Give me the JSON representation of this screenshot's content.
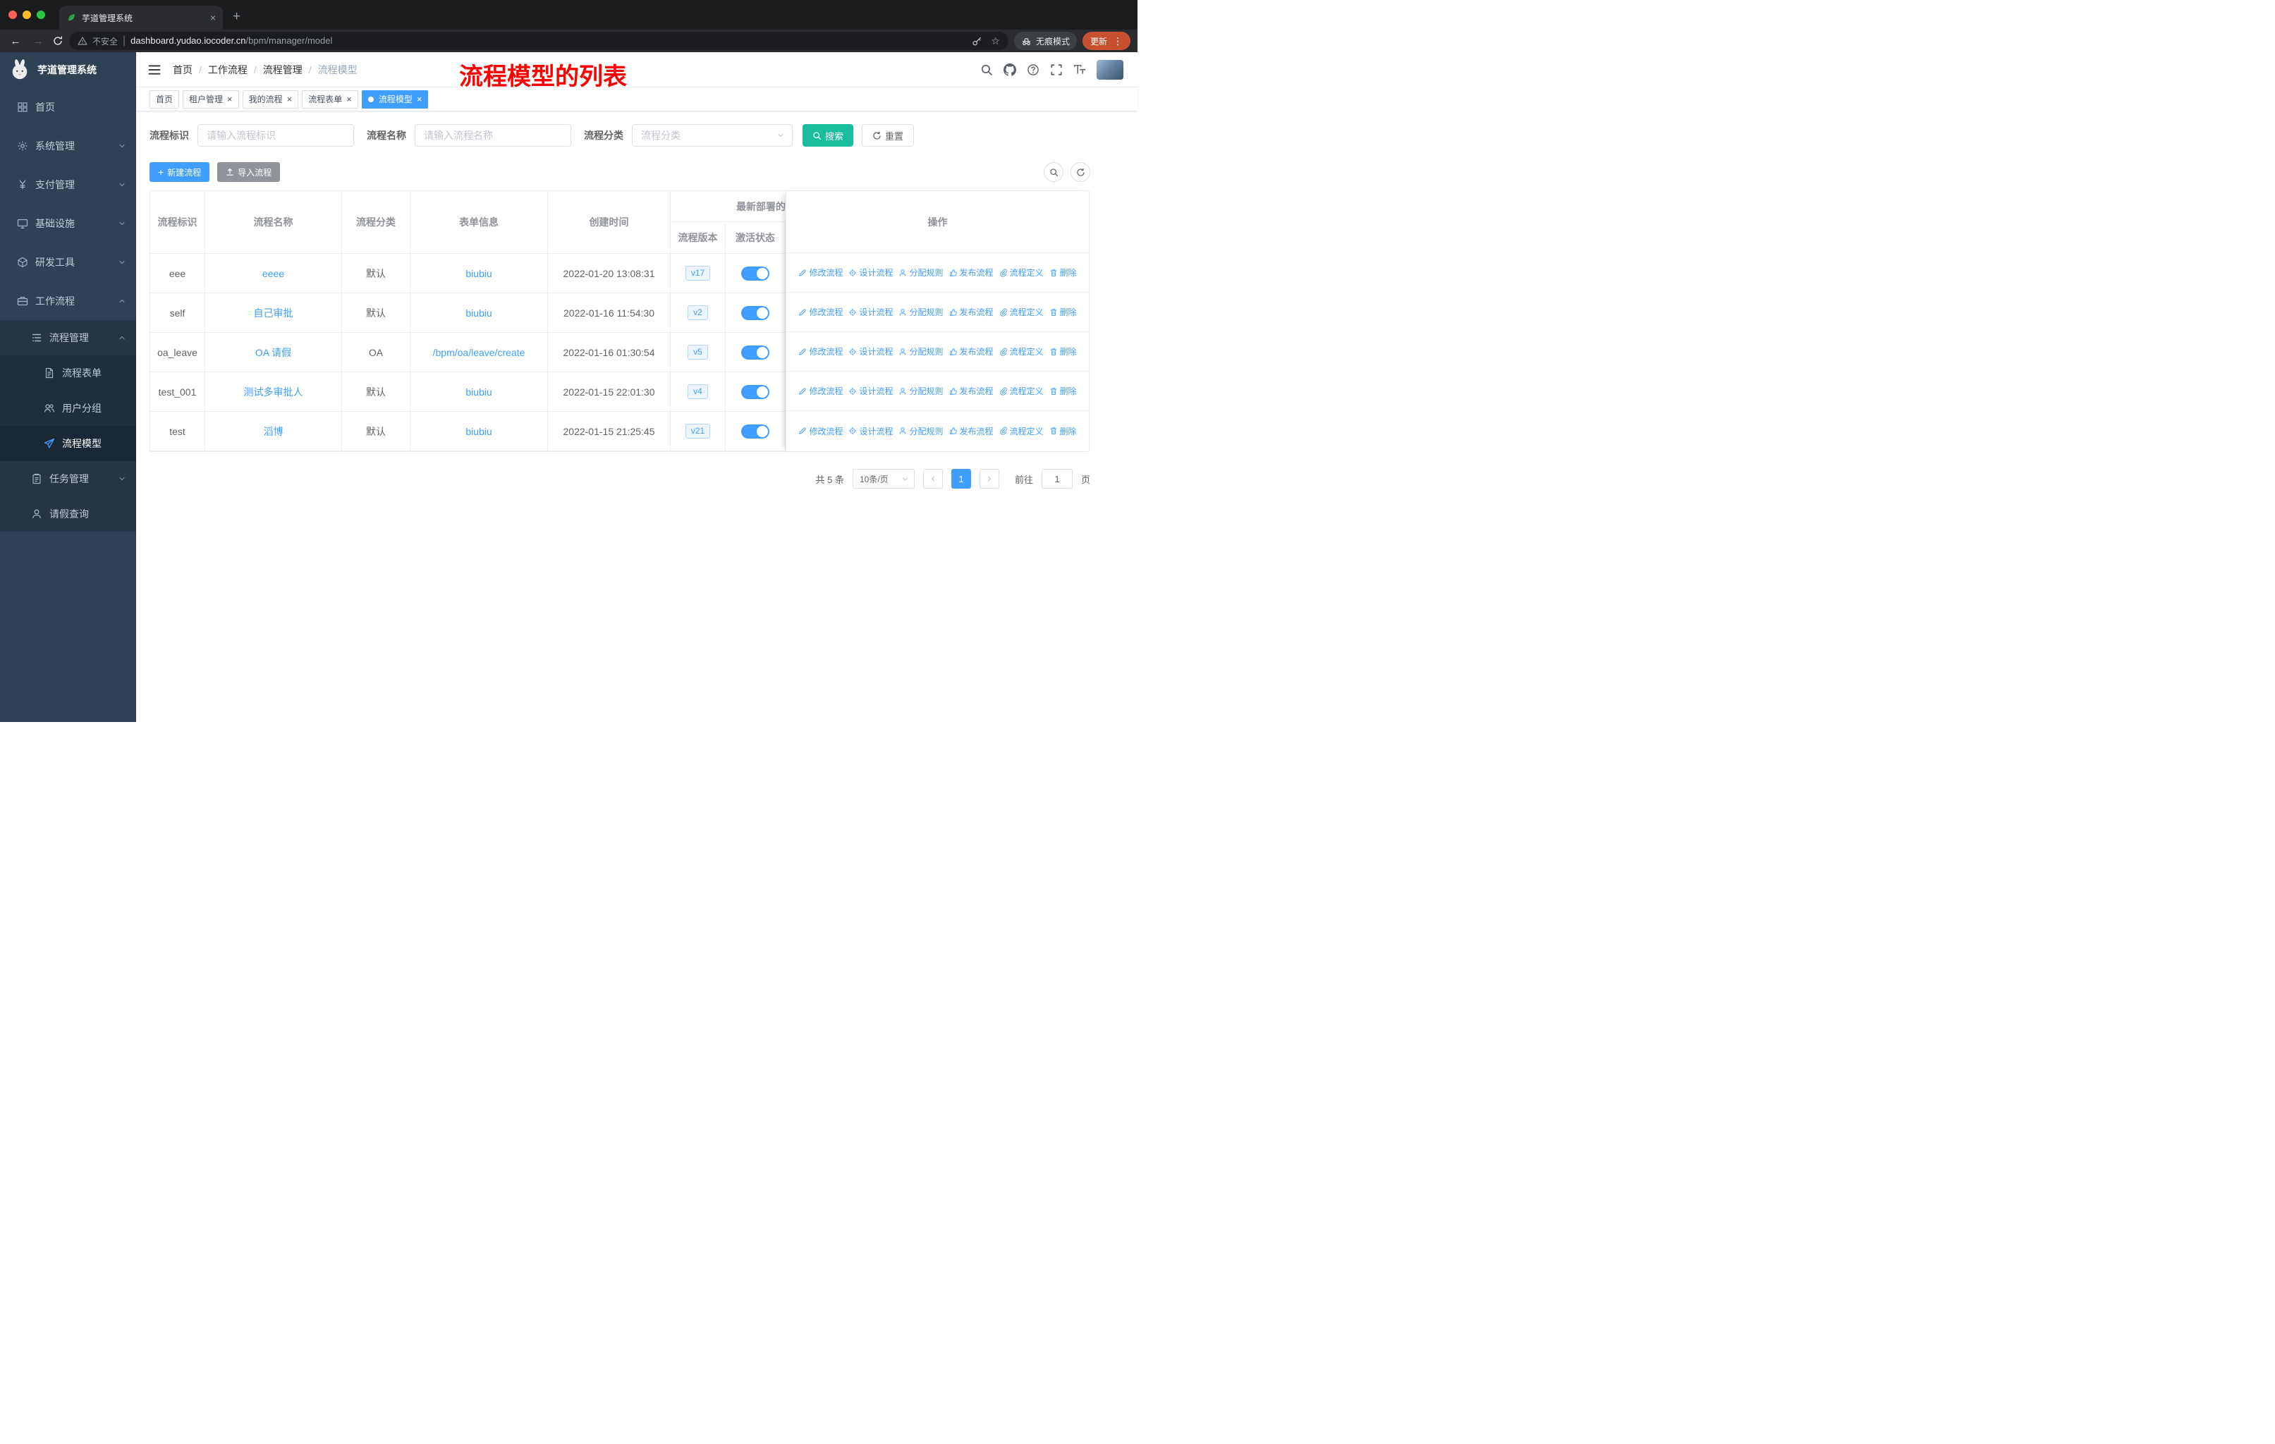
{
  "palette": {
    "accent": "#409EFF",
    "search_button": "#1ABC9C",
    "gray_button": "#909399",
    "sidebar_bg": "#304156",
    "submenu_bg": "#1F2D3D",
    "annotation_red": "#FF0000",
    "toggle_on": "#409EFF",
    "version_badge_bg": "#ECF5FF",
    "table_border": "#EBEEF5",
    "update_pill": "#C8502F"
  },
  "icons": {
    "close_icon": "×",
    "new_tab_icon": "+",
    "back_icon": "←",
    "forward_icon": "→",
    "overflow_menu_icon": "⋮",
    "star_icon": "☆",
    "plus_icon": "+"
  },
  "browser": {
    "tab_title": "芋道管理系统",
    "security_label": "不安全",
    "url_host": "dashboard.yudao.iocoder.cn",
    "url_path": "/bpm/manager/model",
    "incognito_label": "无痕模式",
    "update_label": "更新"
  },
  "sidebar": {
    "logo_title": "芋道管理系统",
    "items": [
      {
        "label": "首页",
        "icon": "dashboard-icon"
      },
      {
        "label": "系统管理",
        "icon": "gear-icon"
      },
      {
        "label": "支付管理",
        "icon": "payment-icon"
      },
      {
        "label": "基础设施",
        "icon": "infrastructure-icon"
      },
      {
        "label": "研发工具",
        "icon": "devtools-icon"
      },
      {
        "label": "工作流程",
        "icon": "workflow-icon"
      },
      {
        "label": "流程管理",
        "icon": "process-management-icon"
      },
      {
        "label": "流程表单",
        "icon": "form-icon"
      },
      {
        "label": "用户分组",
        "icon": "user-group-icon"
      },
      {
        "label": "流程模型",
        "icon": "process-model-icon"
      },
      {
        "label": "任务管理",
        "icon": "task-icon"
      },
      {
        "label": "请假查询",
        "icon": "leave-query-icon"
      }
    ]
  },
  "header": {
    "breadcrumb": [
      "首页",
      "工作流程",
      "流程管理",
      "流程模型"
    ],
    "breadcrumb_sep": "/",
    "annotation": "流程模型的列表"
  },
  "tags": [
    {
      "label": "首页"
    },
    {
      "label": "租户管理"
    },
    {
      "label": "我的流程"
    },
    {
      "label": "流程表单"
    },
    {
      "label": "流程模型"
    }
  ],
  "filters": {
    "key_label": "流程标识",
    "key_placeholder": "请输入流程标识",
    "name_label": "流程名称",
    "name_placeholder": "请输入流程名称",
    "category_label": "流程分类",
    "category_placeholder": "流程分类",
    "search_label": "搜索",
    "reset_label": "重置"
  },
  "toolbar": {
    "create_label": "新建流程",
    "import_label": "导入流程"
  },
  "table": {
    "headers": {
      "key": "流程标识",
      "name": "流程名称",
      "category": "流程分类",
      "form": "表单信息",
      "created": "创建时间",
      "deploy_group": "最新部署的",
      "version": "流程版本",
      "status": "激活状态",
      "actions": "操作"
    },
    "rows": [
      {
        "key": "eee",
        "name": "eeee",
        "category": "默认",
        "form": "biubiu",
        "created": "2022-01-20 13:08:31",
        "version": "v17"
      },
      {
        "key": "self",
        "name": "自己审批",
        "category": "默认",
        "form": "biubiu",
        "created": "2022-01-16 11:54:30",
        "version": "v2"
      },
      {
        "key": "oa_leave",
        "name": "OA 请假",
        "category": "OA",
        "form": "/bpm/oa/leave/create",
        "created": "2022-01-16 01:30:54",
        "version": "v5"
      },
      {
        "key": "test_001",
        "name": "测试多审批人",
        "category": "默认",
        "form": "biubiu",
        "created": "2022-01-15 22:01:30",
        "version": "v4"
      },
      {
        "key": "test",
        "name": "滔博",
        "category": "默认",
        "form": "biubiu",
        "created": "2022-01-15 21:25:45",
        "version": "v21"
      }
    ],
    "row_actions": {
      "edit": "修改流程",
      "design": "设计流程",
      "assign": "分配规则",
      "publish": "发布流程",
      "definition": "流程定义",
      "remove": "删除"
    }
  },
  "pagination": {
    "total": "共 5 条",
    "page_size": "10条/页",
    "current_page": "1",
    "goto_label": "前往",
    "page_unit": "页"
  }
}
